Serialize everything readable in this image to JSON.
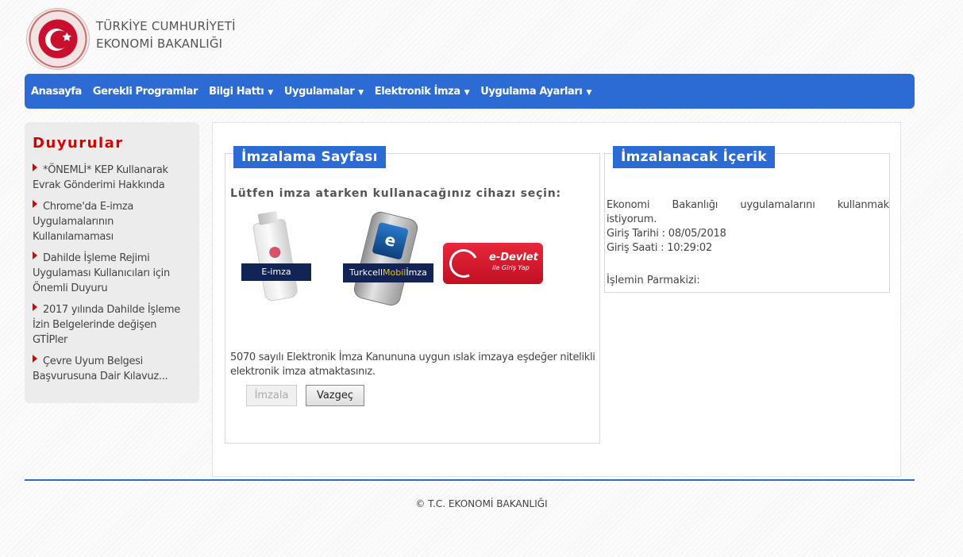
{
  "header": {
    "line1": "TÜRKİYE CUMHURİYETİ",
    "line2": "EKONOMİ BAKANLIĞI"
  },
  "nav": {
    "items": [
      {
        "label": "Anasayfa",
        "dropdown": false
      },
      {
        "label": "Gerekli Programlar",
        "dropdown": false
      },
      {
        "label": "Bilgi Hattı",
        "dropdown": true
      },
      {
        "label": "Uygulamalar",
        "dropdown": true
      },
      {
        "label": "Elektronik İmza",
        "dropdown": true
      },
      {
        "label": "Uygulama Ayarları",
        "dropdown": true
      }
    ]
  },
  "sidebar": {
    "title": "Duyurular",
    "items": [
      {
        "label": "*ÖNEMLİ* KEP Kullanarak Evrak Gönderimi Hakkında"
      },
      {
        "label": "Chrome'da E-imza Uygulamalarının Kullanılamaması"
      },
      {
        "label": "Dahilde İşleme Rejimi Uygulaması Kullanıcıları için Önemli Duyuru"
      },
      {
        "label": "2017 yılında Dahilde İşleme İzin Belgelerinde değişen GTİPler"
      },
      {
        "label": "Çevre Uyum Belgesi Başvurusuna Dair Kılavuz..."
      }
    ]
  },
  "sign_panel": {
    "title": "İmzalama Sayfası",
    "instruction": "Lütfen imza atarken kullanacağınız cihazı seçin:",
    "devices": {
      "eimza_label": "E-imza",
      "turkcell_prefix": "Turkcell",
      "turkcell_mobil": "Mobil",
      "turkcell_suffix": "İmza",
      "turkcell_screen": "e",
      "edevlet_title": "e-Devlet",
      "edevlet_sub": "ile Giriş Yap"
    },
    "legal_text": "5070 sayılı Elektronik İmza Kanununa uygun ıslak imzaya eşdeğer nitelikli elektronik imza atmaktasınız.",
    "sign_button": "İmzala",
    "cancel_button": "Vazgeç"
  },
  "content_panel": {
    "title": "İmzalanacak İçerik",
    "description": "Ekonomi Bakanlığı uygulamalarını kullanmak istiyorum.",
    "date_line": "Giriş Tarihi : 08/05/2018",
    "time_line": "Giriş Saati : 10:29:02",
    "fingerprint_label": "İşlemin Parmakizi:"
  },
  "footer": {
    "text": "© T.C. EKONOMİ BAKANLIĞI"
  },
  "colors": {
    "accent": "#2d6bd4",
    "announcement_red": "#d40000",
    "brand_navy": "#122356"
  }
}
